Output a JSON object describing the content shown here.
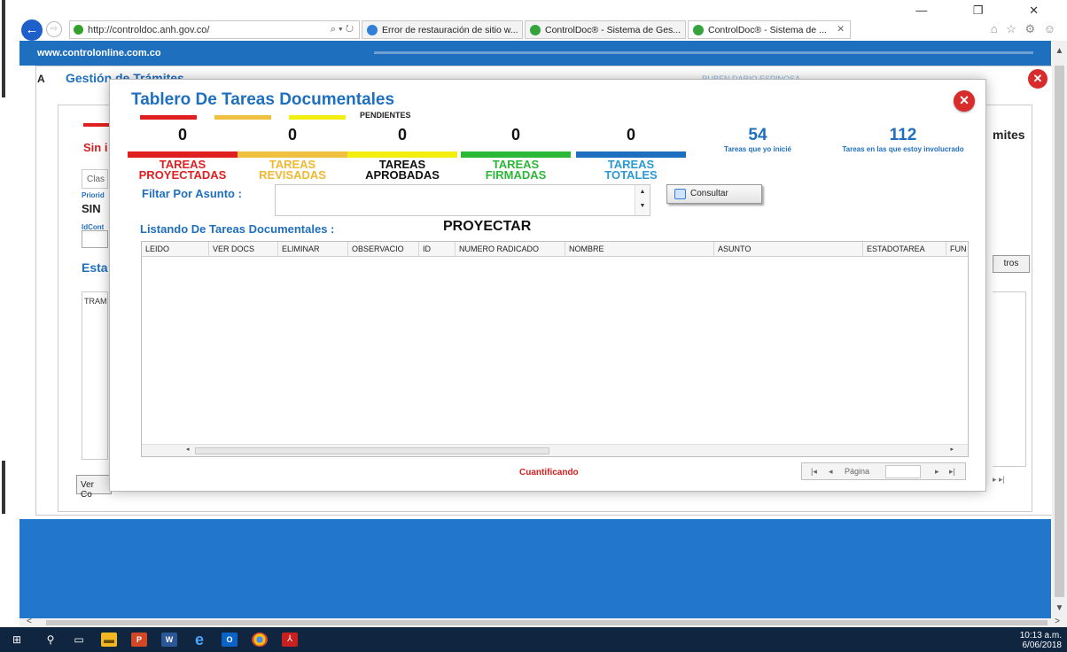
{
  "browser": {
    "url": "http://controldoc.anh.gov.co/",
    "url_controls": "⌕ ▾ ↻",
    "tabs": [
      {
        "label": "Error de restauración de sitio w...",
        "icon_color": "#2f7fd6"
      },
      {
        "label": "ControlDoc® - Sistema de Ges...",
        "icon_color": "#35a33c"
      },
      {
        "label": "ControlDoc® - Sistema de ...",
        "icon_color": "#35a33c",
        "active": true
      }
    ],
    "window_controls": "— ❐ ✕",
    "fav_icons": "⌂ ☆ ⚙ ☺"
  },
  "site": {
    "name": "www.controlonline.com.co"
  },
  "background_page": {
    "title": "Gestión de Trámites",
    "subtitle": "RUBEN DARIO ESPINOSA",
    "tab_label": "A",
    "tramites": "mites",
    "sin": "Sin i",
    "clas": "Clas",
    "prioridad": "Priorid",
    "sin_value": "SIN",
    "idcont": "IdCont",
    "esta": "Esta",
    "tram": "TRAM",
    "otros": "tros",
    "ver_comp": "Ver Co",
    "pager": "▸ ▸|"
  },
  "modal": {
    "title": "Tablero De Tareas Documentales",
    "legend_label": "PENDIENTES",
    "legend_colors": [
      "#e02020",
      "#f0c040",
      "#f2ee10"
    ],
    "stages": [
      {
        "count": "0",
        "label_1": "TAREAS",
        "label_2": "PROYECTADAS",
        "bar_color": "#e02020",
        "text_color": "#e02020"
      },
      {
        "count": "0",
        "label_1": "TAREAS",
        "label_2": "REVISADAS",
        "bar_color": "#f0c040",
        "text_color": "#f0b830"
      },
      {
        "count": "0",
        "label_1": "TAREAS",
        "label_2": "APROBADAS",
        "bar_color": "#f2ee10",
        "text_color": "#111111"
      },
      {
        "count": "0",
        "label_1": "TAREAS",
        "label_2": "FIRMADAS",
        "bar_color": "#2cb837",
        "text_color": "#2cb837"
      },
      {
        "count": "0",
        "label_1": "TAREAS",
        "label_2": "TOTALES",
        "bar_color": "#1f6fbf",
        "text_color": "#2a9ad6"
      }
    ],
    "stats": [
      {
        "value": "54",
        "label": "Tareas que yo inicié"
      },
      {
        "value": "112",
        "label": "Tareas en las que estoy involucrado"
      }
    ],
    "filter_label": "Filtar Por Asunto :",
    "filter_value": "",
    "consult_button": "Consultar",
    "list_title": "Listando De Tareas Documentales :",
    "list_mode": "PROYECTAR",
    "columns": [
      "LEIDO",
      "VER DOCS",
      "ELIMINAR",
      "OBSERVACIO",
      "ID",
      "NUMERO RADICADO",
      "NOMBRE",
      "ASUNTO",
      "ESTADOTAREA",
      "FUN"
    ],
    "status_text": "Cuantificando",
    "pager": {
      "first": "|◂",
      "prev": "◂",
      "label": "Página",
      "next": "▸",
      "last": "▸|"
    }
  },
  "taskbar": {
    "time": "10:13 a.m.",
    "date": "6/06/2018"
  }
}
